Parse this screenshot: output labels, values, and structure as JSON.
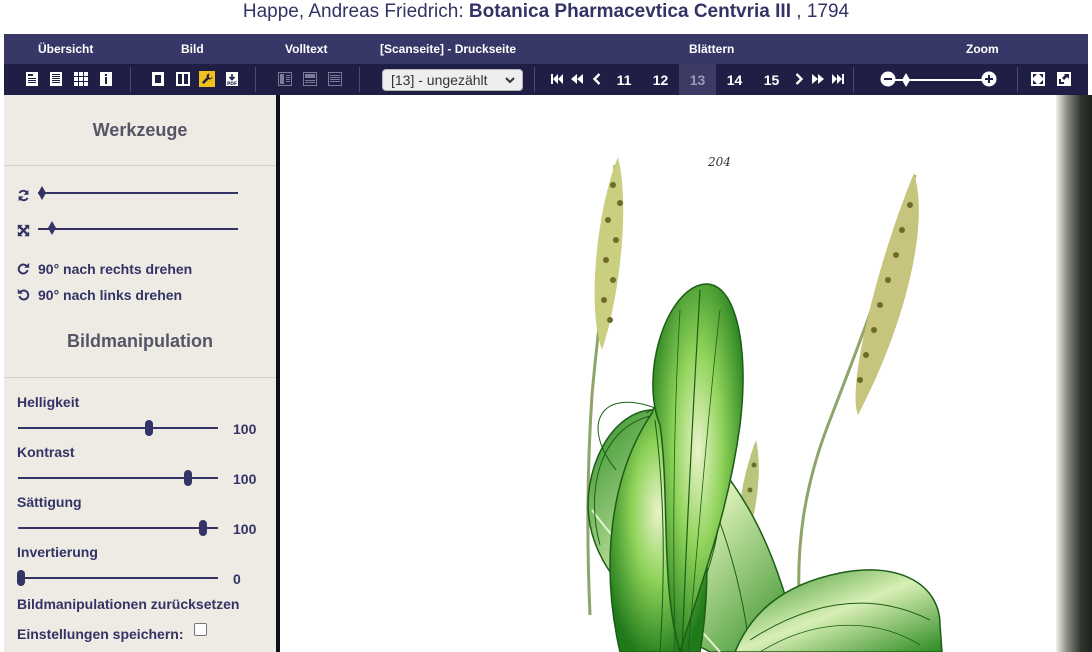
{
  "header": {
    "author": "Happe, Andreas Friedrich:",
    "work_title": "Botanica Pharmacevtica Centvria III",
    "year_sep": ",",
    "year": "1794"
  },
  "toolbar": {
    "labels": {
      "overview": "Übersicht",
      "image": "Bild",
      "fulltext": "Volltext",
      "scanpage": "[Scanseite] - Druckseite",
      "browse": "Blättern",
      "zoom": "Zoom"
    },
    "page_select": {
      "selected": "[13] - ungezählt"
    },
    "pages": [
      {
        "label": "11",
        "current": false
      },
      {
        "label": "12",
        "current": false
      },
      {
        "label": "13",
        "current": true
      },
      {
        "label": "14",
        "current": false
      },
      {
        "label": "15",
        "current": false
      }
    ]
  },
  "sidebar": {
    "tools_title": "Werkzeuge",
    "rotate_right": "90° nach rechts drehen",
    "rotate_left": "90° nach links drehen",
    "image_manipulation_title": "Bildmanipulation",
    "brightness": {
      "label": "Helligkeit",
      "value": "100"
    },
    "contrast": {
      "label": "Kontrast",
      "value": "100"
    },
    "saturation": {
      "label": "Sättigung",
      "value": "100"
    },
    "inversion": {
      "label": "Invertierung",
      "value": "0"
    },
    "reset": "Bildmanipulationen zurücksetzen",
    "save_settings": "Einstellungen speichern:"
  },
  "viewer": {
    "page_annotation": "204"
  },
  "colors": {
    "toolbar_top": "#383868",
    "toolbar_bottom": "#1f1f45",
    "sidebar_bg": "#eeeae4",
    "accent_text": "#333366",
    "page_select_icon": "#f2c01d"
  }
}
